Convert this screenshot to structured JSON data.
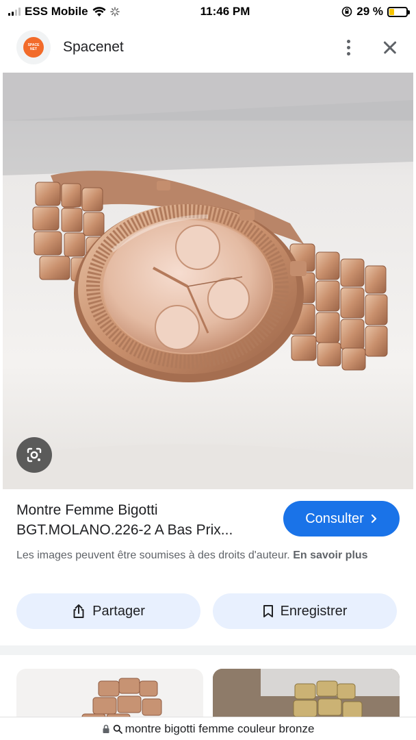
{
  "status_bar": {
    "carrier": "ESS Mobile",
    "time": "11:46 PM",
    "battery_percent": "29 %",
    "battery_level": 0.29
  },
  "header": {
    "site_logo_text_line1": "SPACE",
    "site_logo_text_line2": "NET",
    "site_name": "Spacenet"
  },
  "result": {
    "title": "Montre Femme Bigotti BGT.MOLANO.226-2 A Bas Prix...",
    "consult_label": "Consulter",
    "copyright_text": "Les images peuvent être soumises à des droits d'auteur.",
    "learn_more": "En savoir plus"
  },
  "actions": {
    "share_label": "Partager",
    "save_label": "Enregistrer"
  },
  "url_bar": {
    "query": "montre bigotti femme couleur bronze"
  },
  "colors": {
    "accent": "#1a73e8",
    "action_bg": "#e8f0fe",
    "brand_logo": "#f26b2a"
  }
}
